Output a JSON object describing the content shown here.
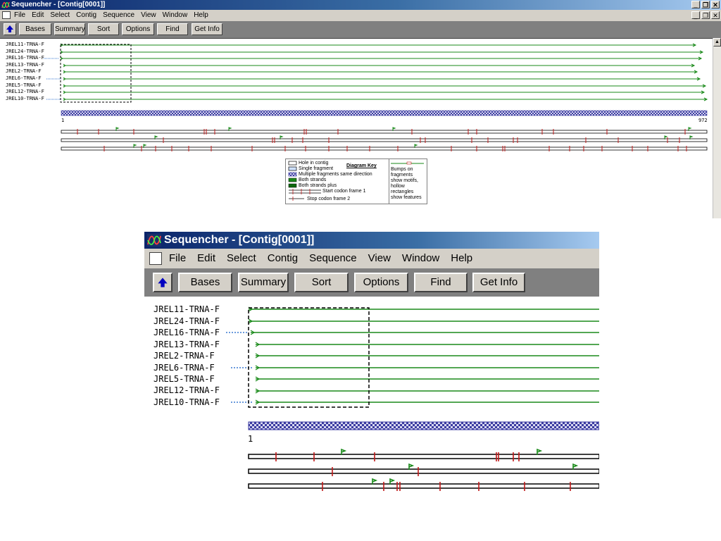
{
  "window": {
    "title": "Sequencher - [Contig[0001]]",
    "title_buttons": [
      "_",
      "❐",
      "✕"
    ],
    "menu_buttons": [
      "_",
      "❐",
      "✕"
    ]
  },
  "menu": [
    "File",
    "Edit",
    "Select",
    "Contig",
    "Sequence",
    "View",
    "Window",
    "Help"
  ],
  "toolbar": {
    "up_icon": "up-arrow-icon",
    "buttons": [
      "Bases",
      "Summary",
      "Sort",
      "Options",
      "Find",
      "Get Info"
    ]
  },
  "fragments": [
    "JREL11-TRNA-F",
    "JREL24-TRNA-F",
    "JREL16-TRNA-F",
    "JREL13-TRNA-F",
    "JREL2-TRNA-F",
    "JREL6-TRNA-F",
    "JREL5-TRNA-F",
    "JREL12-TRNA-F",
    "JREL10-TRNA-F"
  ],
  "contig": {
    "start": "1",
    "end": "972"
  },
  "diagram_key": {
    "title": "Diagram Key",
    "items": [
      "Hole in contig",
      "Single fragment",
      "Multiple fragments same direction",
      "Both strands",
      "Both strands plus"
    ],
    "start_codon": "Start codon frame 1",
    "stop_codon": "Stop codon frame 2",
    "note": [
      "Bumps on",
      "fragments",
      "show motifs,",
      "hollow",
      "rectangles",
      "show features"
    ]
  },
  "zoom": {
    "title": "Sequencher - [Contig[0001]]",
    "start": "1"
  },
  "colors": {
    "fragment_line": "#1a8a1a",
    "stop_codon": "#c01818",
    "start_codon": "#1a8a1a",
    "consensus": "#3a3aa0",
    "dotted_lead": "#3a7ad0"
  }
}
